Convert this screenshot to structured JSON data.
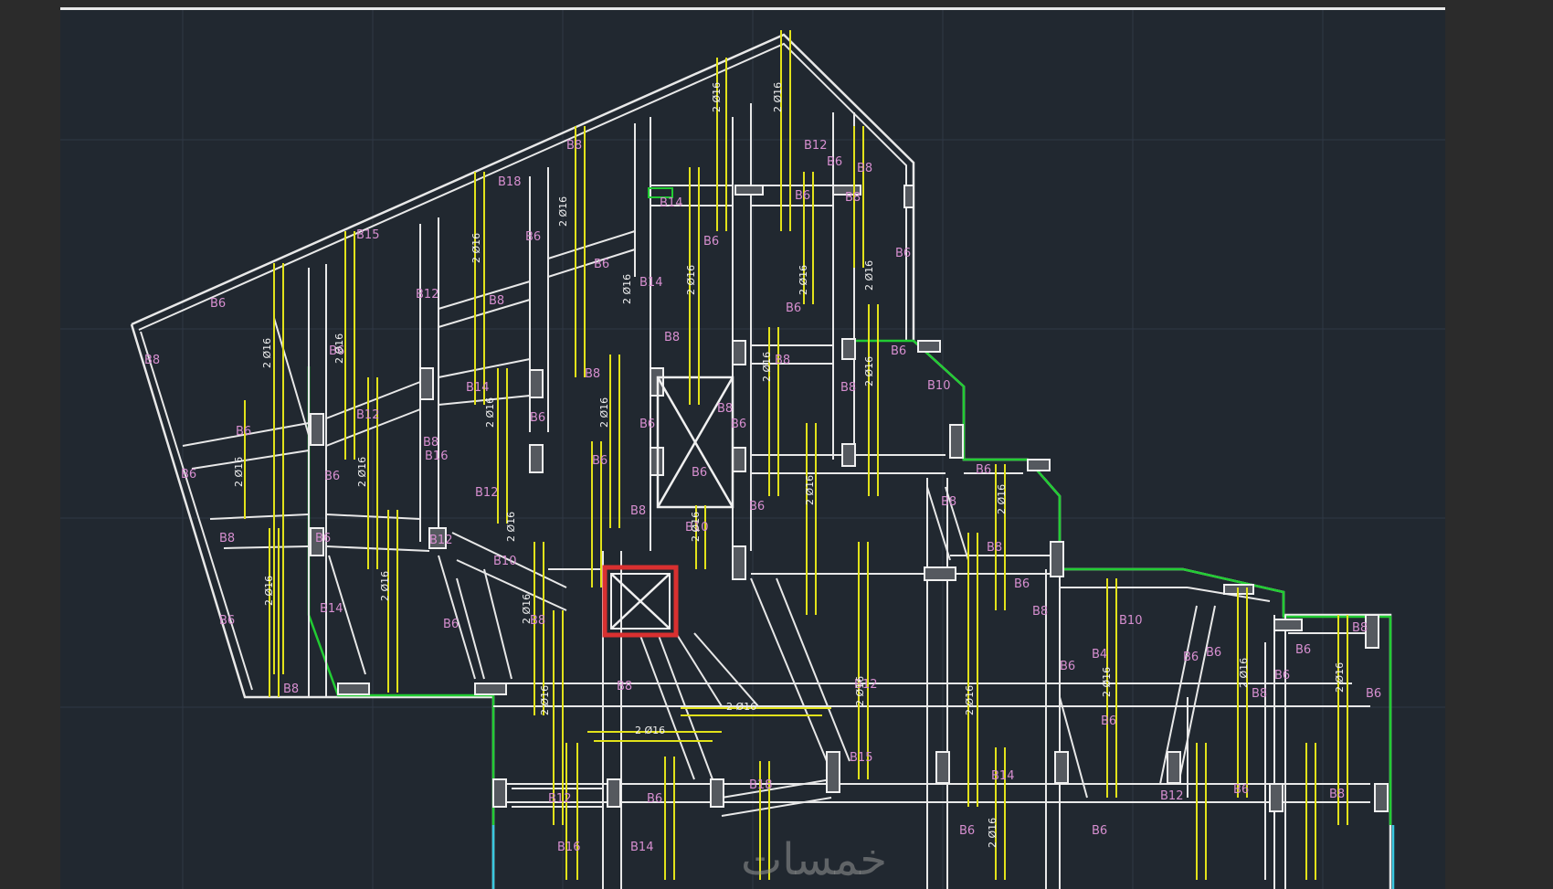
{
  "drawing": {
    "colors": {
      "background": "#212830",
      "grid": "#2f3845",
      "walls": "#e8e8e8",
      "reinforcement": "#e2e21a",
      "labels": "#d78fd0",
      "boundary": "#22cc33",
      "core": "#d93030",
      "edge": "#38c8e0"
    },
    "beam_labels": [
      "B6",
      "B8",
      "B6",
      "B6",
      "B8",
      "B6",
      "B8",
      "B6",
      "B12",
      "B6",
      "B6",
      "B14",
      "B15",
      "B12",
      "B8",
      "B14",
      "B16",
      "B12",
      "B6",
      "B18",
      "B6",
      "B8",
      "B6",
      "B12",
      "B10",
      "B8",
      "B8",
      "B6",
      "B8",
      "B6",
      "B14",
      "B6",
      "B8",
      "B14",
      "B8",
      "B6",
      "B6",
      "B10",
      "B8",
      "B6",
      "B6",
      "B8",
      "B6",
      "B12",
      "B6",
      "B6",
      "B8",
      "B8",
      "B6",
      "B8",
      "B6",
      "B10",
      "B8",
      "B6",
      "B8",
      "B6",
      "B8",
      "B6",
      "B4",
      "B6",
      "B10",
      "B6"
    ],
    "bar_labels": [
      "2 Ø16",
      "2 Ø16",
      "2 Ø16",
      "2 Ø16",
      "2 Ø16",
      "2 Ø16",
      "2 Ø16",
      "2 Ø16",
      "2 Ø16",
      "2 Ø16",
      "2 Ø16",
      "2 Ø16",
      "2 Ø16",
      "2 Ø16",
      "2 Ø16",
      "2 Ø16",
      "2 Ø16",
      "2 Ø16",
      "2 Ø16",
      "2 Ø16",
      "2 Ø16",
      "2 Ø16",
      "2 Ø16",
      "2 Ø16",
      "2 Ø16",
      "2 Ø16",
      "2 Ø16",
      "2 Ø16",
      "2 Ø16",
      "2 Ø16"
    ],
    "watermark": "خمسات"
  }
}
